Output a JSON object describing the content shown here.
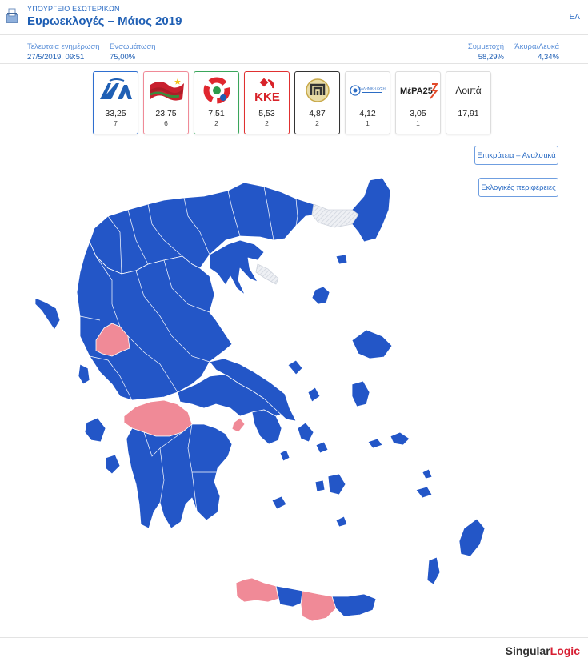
{
  "header": {
    "ministry": "ΥΠΟΥΡΓΕΙΟ ΕΣΩΤΕΡΙΚΩΝ",
    "title": "Ευρωεκλογές – Μάιος 2019",
    "language": "ΕΛ",
    "logo_icon": "ballot-box-icon"
  },
  "info": {
    "last_update_label": "Τελευταία ενημέρωση",
    "last_update_value": "27/5/2019, 09:51",
    "integration_label": "Ενσωμάτωση",
    "integration_value": "75,00%",
    "turnout_label": "Συμμετοχή",
    "turnout_value": "58,29%",
    "invalid_label": "Άκυρα/Λευκά",
    "invalid_value": "4,34%"
  },
  "parties": [
    {
      "key": "nd",
      "logo_text": "ΝΔ",
      "percent": "33,25",
      "seats": "7",
      "color": "#2f6fd0",
      "selected": true
    },
    {
      "key": "syriza",
      "logo_text": "",
      "percent": "23,75",
      "seats": "6",
      "color": "#f08a97",
      "selected": true
    },
    {
      "key": "kinal",
      "logo_text": "",
      "percent": "7,51",
      "seats": "2",
      "color": "#3aa65a",
      "selected": true
    },
    {
      "key": "kke",
      "logo_text": "ΚΚΕ",
      "percent": "5,53",
      "seats": "2",
      "color": "#e03030",
      "selected": true
    },
    {
      "key": "xa",
      "logo_text": "",
      "percent": "4,87",
      "seats": "2",
      "color": "#333333",
      "selected": true
    },
    {
      "key": "el",
      "logo_text": "ΕΛΛΗΝΙΚΗ ΛΥΣΗ",
      "percent": "4,12",
      "seats": "1",
      "color": "#dddddd",
      "selected": false
    },
    {
      "key": "mera25",
      "logo_text": "ΜέΡΑ25",
      "percent": "3,05",
      "seats": "1",
      "color": "#dddddd",
      "selected": false
    },
    {
      "key": "other",
      "logo_text": "Λοιπά",
      "percent": "17,91",
      "seats": "",
      "color": "#dddddd",
      "selected": false
    }
  ],
  "buttons": {
    "state_details": "Επικράτεια – Αναλυτικά",
    "constituencies": "Εκλογικές περιφέρειες"
  },
  "map": {
    "colors": {
      "nd": "#2356c7",
      "syriza": "#f08a97",
      "no_data": "#e3e6ec",
      "border": "#ffffff"
    }
  },
  "footer": {
    "brand_a": "Singular",
    "brand_b": "Logic"
  }
}
